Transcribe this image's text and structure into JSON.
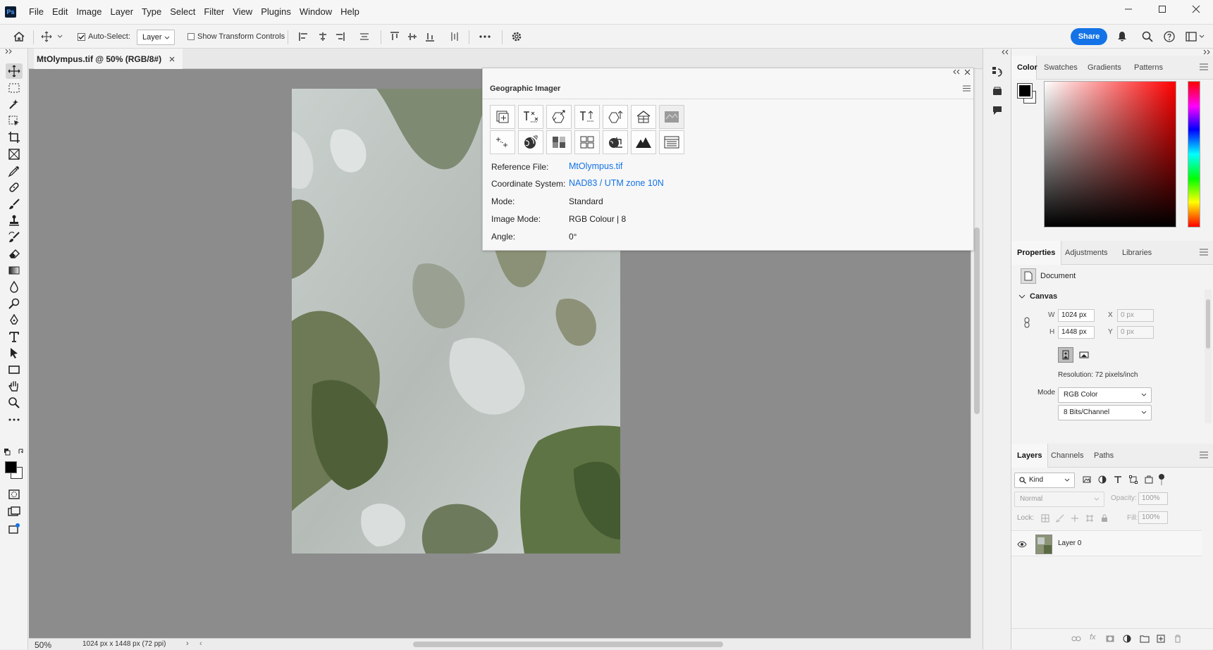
{
  "app": {
    "logo_text": "Ps"
  },
  "menubar": {
    "items": [
      "File",
      "Edit",
      "Image",
      "Layer",
      "Type",
      "Select",
      "Filter",
      "View",
      "Plugins",
      "Window",
      "Help"
    ]
  },
  "options_bar": {
    "auto_select_label": "Auto-Select:",
    "auto_select_checked": true,
    "layer_dropdown": "Layer",
    "show_transform_label": "Show Transform Controls",
    "show_transform_checked": false,
    "share_label": "Share"
  },
  "document": {
    "tab_title": "MtOlympus.tif @ 50% (RGB/8#)"
  },
  "statusbar": {
    "zoom": "50%",
    "info": "1024 px x 1448 px (72 ppi)"
  },
  "geo_panel": {
    "title": "Geographic Imager",
    "rows": [
      {
        "label": "Reference File:",
        "value": "MtOlympus.tif",
        "link": true
      },
      {
        "label": "Coordinate System:",
        "value": "NAD83 / UTM zone 10N",
        "link": true
      },
      {
        "label": "Mode:",
        "value": "Standard",
        "link": false
      },
      {
        "label": "Image Mode:",
        "value": "RGB Colour | 8",
        "link": false
      },
      {
        "label": "Angle:",
        "value": "0°",
        "link": false
      }
    ]
  },
  "color_panel": {
    "tabs": [
      "Color",
      "Swatches",
      "Gradients",
      "Patterns"
    ],
    "active": "Color",
    "fg": "#000000",
    "bg": "#ffffff"
  },
  "properties_panel": {
    "tabs": [
      "Properties",
      "Adjustments",
      "Libraries"
    ],
    "doc_label": "Document",
    "section": "Canvas",
    "w_label": "W",
    "w_value": "1024 px",
    "h_label": "H",
    "h_value": "1448 px",
    "x_label": "X",
    "x_value": "0 px",
    "y_label": "Y",
    "y_value": "0 px",
    "resolution": "Resolution: 72 pixels/inch",
    "mode_label": "Mode",
    "mode_value": "RGB Color",
    "depth_value": "8 Bits/Channel"
  },
  "layers_panel": {
    "tabs": [
      "Layers",
      "Channels",
      "Paths"
    ],
    "kind_label": "Kind",
    "blend_mode": "Normal",
    "opacity_label": "Opacity:",
    "opacity_value": "100%",
    "lock_label": "Lock:",
    "fill_label": "Fill:",
    "fill_value": "100%",
    "layers": [
      {
        "name": "Layer 0",
        "visible": true
      }
    ]
  }
}
